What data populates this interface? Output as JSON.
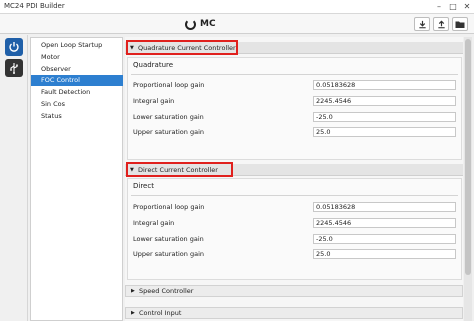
{
  "window": {
    "title": "MC24 PDI Builder"
  },
  "toolbar": {
    "app_name": "MC",
    "buttons": [
      {
        "icon": "download-icon"
      },
      {
        "icon": "upload-icon"
      },
      {
        "icon": "folder-icon"
      }
    ]
  },
  "rail": {
    "items": [
      {
        "icon": "power-icon"
      },
      {
        "icon": "usb-icon"
      }
    ]
  },
  "nav": {
    "items": [
      {
        "label": "Open Loop Startup"
      },
      {
        "label": "Motor"
      },
      {
        "label": "Observer"
      },
      {
        "label": "FOC Control",
        "selected": true
      },
      {
        "label": "Fault Detection"
      },
      {
        "label": "Sin Cos"
      },
      {
        "label": "Status"
      }
    ]
  },
  "sections": [
    {
      "header": "Quadrature Current Controller",
      "group_title": "Quadrature",
      "fields": [
        {
          "label": "Proportional loop gain",
          "value": "0.05183628"
        },
        {
          "label": "Integral gain",
          "value": "2245.4546"
        },
        {
          "label": "Lower saturation gain",
          "value": "-25.0"
        },
        {
          "label": "Upper saturation gain",
          "value": "25.0"
        }
      ]
    },
    {
      "header": "Direct Current Controller",
      "group_title": "Direct",
      "fields": [
        {
          "label": "Proportional loop gain",
          "value": "0.05183628"
        },
        {
          "label": "Integral gain",
          "value": "2245.4546"
        },
        {
          "label": "Lower saturation gain",
          "value": "-25.0"
        },
        {
          "label": "Upper saturation gain",
          "value": "25.0"
        }
      ]
    }
  ],
  "collapsed_sections": [
    {
      "header": "Speed Controller"
    },
    {
      "header": "Control Input"
    }
  ],
  "colors": {
    "accent": "#2d7fd0",
    "highlight_box": "#e0201d",
    "rail_icon_bg": "#1f5fa8"
  }
}
